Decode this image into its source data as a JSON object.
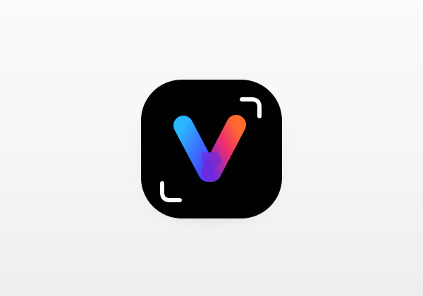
{
  "app_icon": {
    "logo_text": "V",
    "background_color": "#020102",
    "corner_mark_color": "#ffffff",
    "gradient": {
      "left_stroke_start": "#29b7ff",
      "left_stroke_end": "#4d39ff",
      "right_stroke_start": "#ff6b2f",
      "right_stroke_mid": "#ef2d6f",
      "right_stroke_end": "#6d2bde",
      "overlap_tint": "#7a25d6"
    },
    "icons": {
      "logo": "v-logo-icon",
      "frame_top_right": "frame-corner-top-right-icon",
      "frame_bottom_left": "frame-corner-bottom-left-icon"
    }
  }
}
